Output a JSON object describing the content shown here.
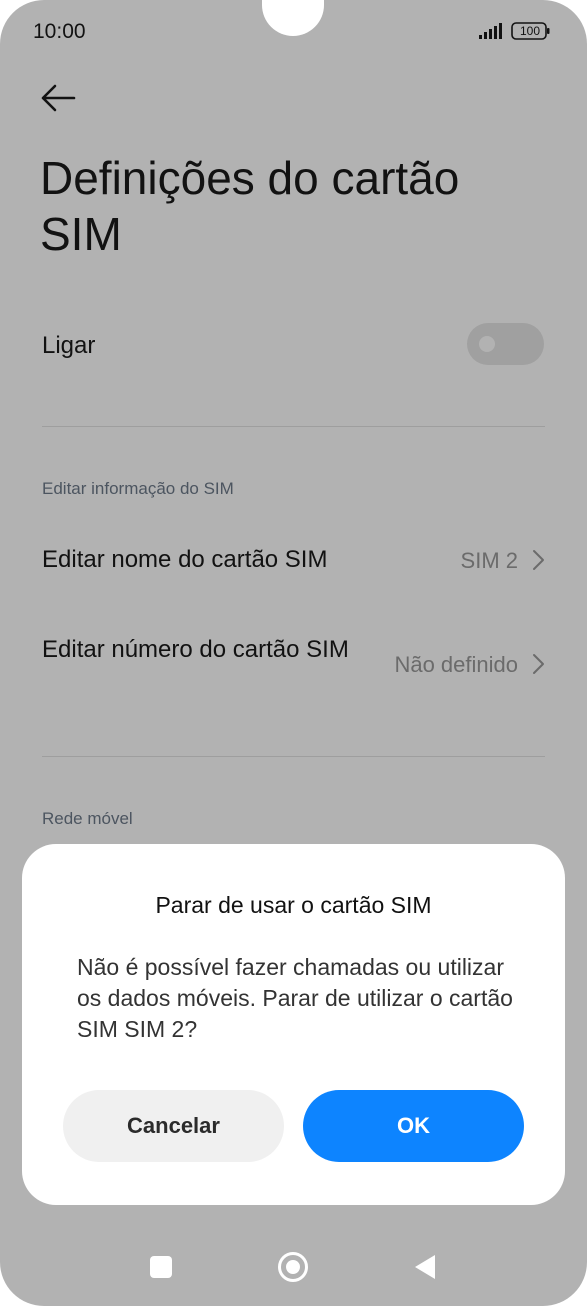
{
  "status_bar": {
    "time": "10:00",
    "battery": "100",
    "icons": [
      "signal-icon",
      "battery-icon"
    ]
  },
  "header": {
    "back_icon": "arrow-left-icon",
    "title": "Definições do cartão SIM"
  },
  "settings": {
    "power_toggle": {
      "label": "Ligar",
      "enabled": false
    },
    "sim_info_section": {
      "header": "Editar informação do SIM",
      "items": [
        {
          "label": "Editar nome do cartão SIM",
          "value": "SIM 2"
        },
        {
          "label": "Editar número do cartão SIM",
          "value": "Não definido"
        }
      ]
    },
    "mobile_network_section": {
      "header": "Rede móvel"
    }
  },
  "dialog": {
    "title": "Parar de usar o cartão SIM",
    "message": "Não é possível fazer chamadas ou utilizar os dados móveis. Parar de utilizar o cartão SIM SIM 2?",
    "cancel_label": "Cancelar",
    "ok_label": "OK"
  },
  "nav_bar": {
    "icons": [
      "recent-apps-icon",
      "home-icon",
      "back-triangle-icon"
    ]
  },
  "colors": {
    "accent": "#0d84ff",
    "scrim": "rgba(0,0,0,0.30)",
    "section_header": "#6e7a8a",
    "value_text": "#9a9a9a"
  }
}
